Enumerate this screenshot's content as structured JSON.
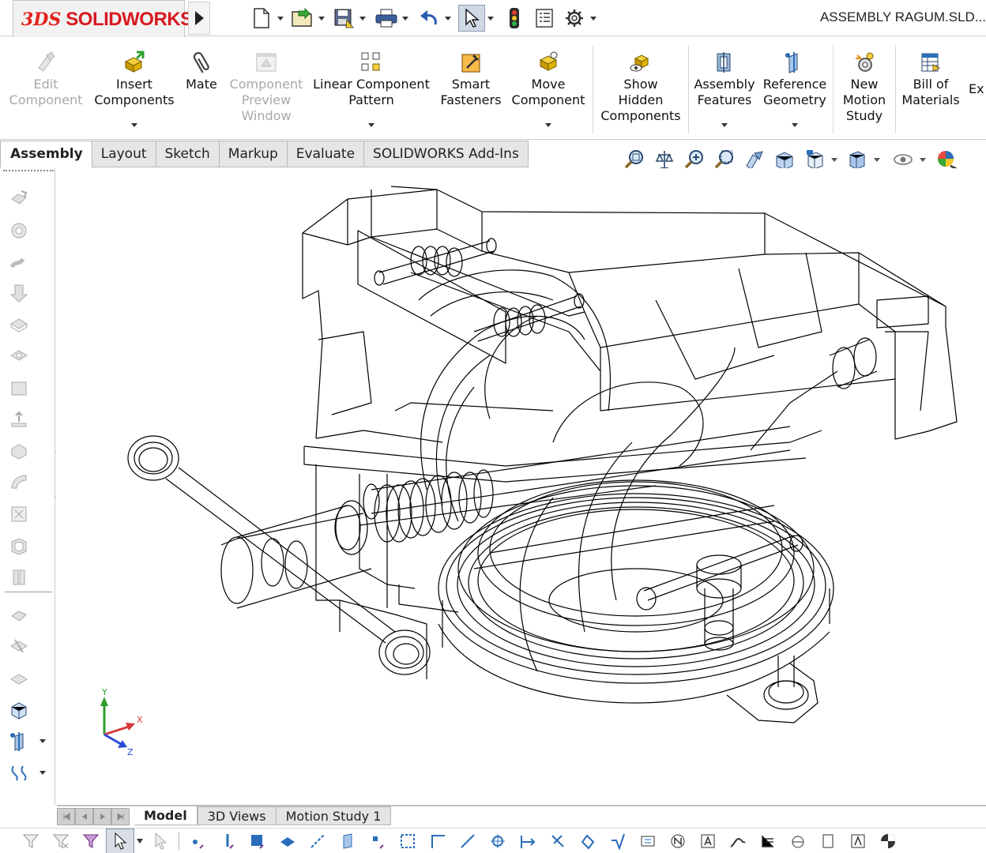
{
  "app": {
    "logo_mark": "3DS",
    "logo_text": "SOLIDWORKS"
  },
  "title": "ASSEMBLY RAGUM.SLD...",
  "quick_access": [
    {
      "name": "new-document-icon"
    },
    {
      "name": "open-document-icon"
    },
    {
      "name": "save-icon"
    },
    {
      "name": "print-icon"
    },
    {
      "name": "undo-icon"
    },
    {
      "name": "select-arrow-icon"
    },
    {
      "name": "rebuild-traffic-light-icon"
    },
    {
      "name": "file-properties-icon"
    },
    {
      "name": "options-gear-icon"
    }
  ],
  "ribbon": {
    "edit_component": "Edit\nComponent",
    "insert_components": "Insert\nComponents",
    "mate": "Mate",
    "component_preview": "Component\nPreview\nWindow",
    "linear_pattern": "Linear Component\nPattern",
    "smart_fasteners": "Smart\nFasteners",
    "move_component": "Move\nComponent",
    "show_hidden": "Show\nHidden\nComponents",
    "assembly_features": "Assembly\nFeatures",
    "reference_geometry": "Reference\nGeometry",
    "new_motion_study": "New\nMotion\nStudy",
    "bill_of_materials": "Bill of\nMaterials",
    "exploded": "Ex"
  },
  "tabs": [
    "Assembly",
    "Layout",
    "Sketch",
    "Markup",
    "Evaluate",
    "SOLIDWORKS Add-Ins"
  ],
  "active_tab": "Assembly",
  "triad": {
    "x": "X",
    "y": "Y",
    "z": "Z"
  },
  "bottom_tabs": [
    "Model",
    "3D Views",
    "Motion Study 1"
  ],
  "active_bottom_tab": "Model",
  "colors": {
    "brand_red": "#d71920",
    "active_bg": "#cfd8e4",
    "accent_blue": "#2a6ebb"
  }
}
